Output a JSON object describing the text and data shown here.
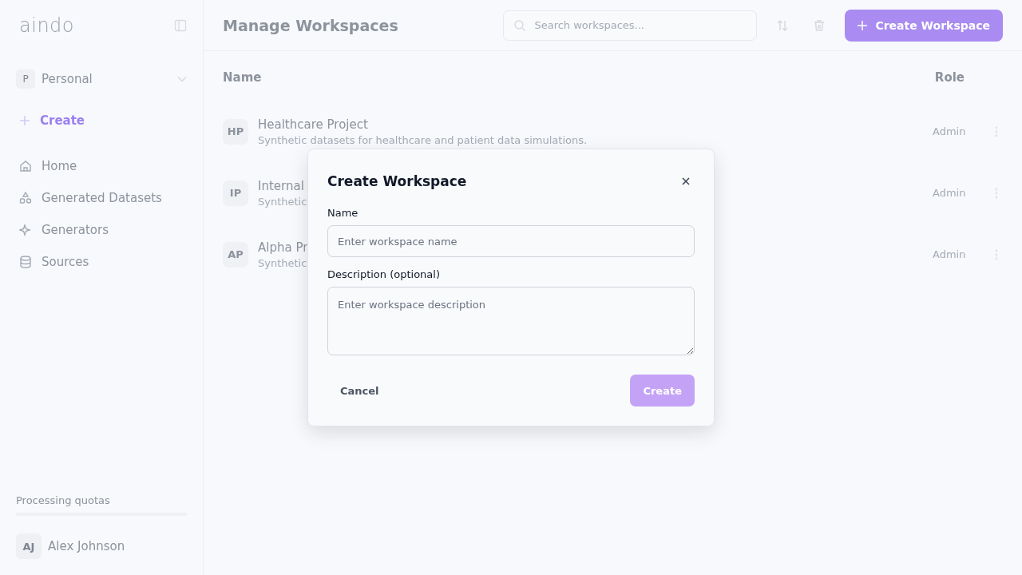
{
  "sidebar": {
    "logo": "aindo",
    "workspace": {
      "initial": "P",
      "name": "Personal"
    },
    "create": "Create",
    "nav": [
      {
        "label": "Home",
        "selected": false
      },
      {
        "label": "Generated Datasets",
        "selected": false
      },
      {
        "label": "Generators",
        "selected": false
      },
      {
        "label": "Sources",
        "selected": false
      }
    ],
    "quotas": "Processing quotas",
    "user": {
      "initials": "AJ",
      "name": "Alex Johnson"
    }
  },
  "header": {
    "title": "Manage Workspaces",
    "search": {
      "placeholder": "Search workspaces..."
    },
    "create_button": "Create Workspace"
  },
  "table": {
    "columns": [
      "Name",
      "Role"
    ],
    "rows": [
      {
        "initials": "HP",
        "name": "Healthcare Project",
        "description": "Synthetic datasets for healthcare and patient data simulations.",
        "role": "Admin"
      },
      {
        "initials": "IP",
        "name": "Internal",
        "description": "Synthetic",
        "role": "Admin"
      },
      {
        "initials": "AP",
        "name": "Alpha Pr",
        "description": "Synthetic",
        "role": "Admin"
      }
    ]
  },
  "modal": {
    "title": "Create Workspace",
    "fields": [
      {
        "kind": "input",
        "label": "Name",
        "placeholder": "Enter workspace name"
      },
      {
        "kind": "textarea",
        "label": "Description (optional)",
        "placeholder": "Enter workspace description"
      }
    ],
    "cancel": "Cancel",
    "submit": "Create"
  }
}
